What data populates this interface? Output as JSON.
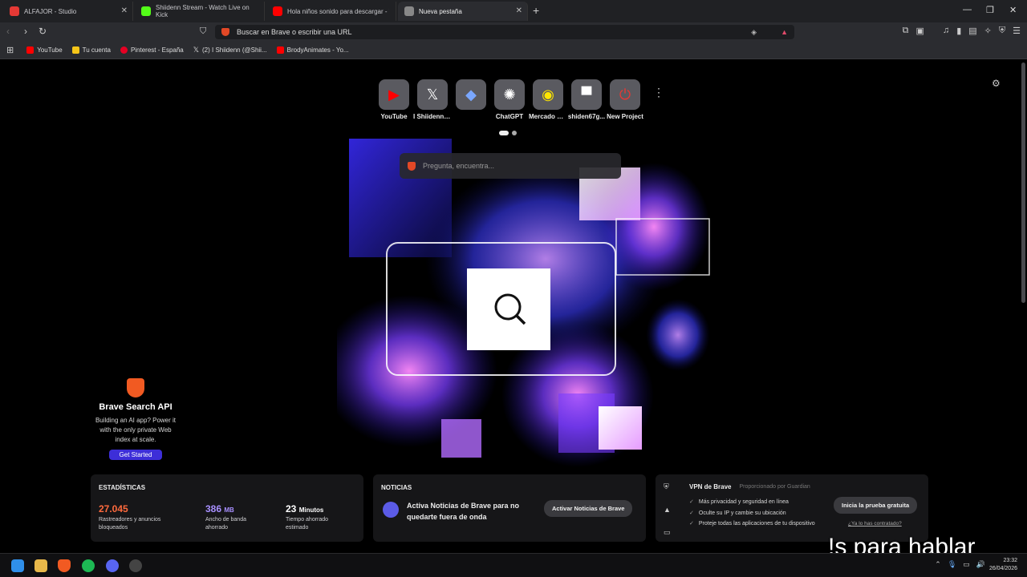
{
  "tabs": [
    {
      "title": "ALFAJOR - Studio",
      "favicon_color": "#e53935"
    },
    {
      "title": "Shiidenn Stream - Watch Live on Kick",
      "favicon_color": "#53fc18"
    },
    {
      "title": "Hola niños sonido para descargar - Y",
      "favicon_color": "#ff0000"
    },
    {
      "title": "Nueva pestaña",
      "favicon_color": "#888888"
    }
  ],
  "toolbar": {
    "address_placeholder": "Buscar en Brave o escribir una URL"
  },
  "bookmarks": [
    {
      "label": "YouTube",
      "color": "#ff0000"
    },
    {
      "label": "Tu cuenta",
      "color": "#f5c518"
    },
    {
      "label": "Pinterest - España",
      "color": "#e60023"
    },
    {
      "label": "(2) I Shiidenn (@Shii...",
      "color": "#ffffff"
    },
    {
      "label": "BrodyAnimates - Yo...",
      "color": "#ff0000"
    }
  ],
  "top_sites": [
    {
      "label": "YouTube",
      "icon": "youtube-icon",
      "color": "#ff0000",
      "glyph": "▶"
    },
    {
      "label": "I Shiidenn (... necesito q...",
      "icon": "x-icon",
      "color": "#ffffff",
      "glyph": "𝕏"
    },
    {
      "label": "",
      "icon": "gemini-icon",
      "color": "#7aa7ff",
      "glyph": "◆"
    },
    {
      "label": "ChatGPT",
      "icon": "chatgpt-icon",
      "color": "#ffffff",
      "glyph": "✺"
    },
    {
      "label": "Mercado Li...",
      "icon": "mercadolibre-icon",
      "color": "#ffe600",
      "glyph": "◉"
    },
    {
      "label": "shiden67g...",
      "icon": "site-icon",
      "color": "#ffffff",
      "glyph": "▀"
    },
    {
      "label": "New Project",
      "icon": "project-icon",
      "color": "#e53935",
      "glyph": "⏻"
    }
  ],
  "ask_placeholder": "Pregunta, encuentra...",
  "api_promo": {
    "title": "Brave Search API",
    "description": "Building an AI app? Power it with the only private Web index at scale.",
    "button": "Get Started"
  },
  "stats": {
    "heading": "ESTADÍSTICAS",
    "trackers_value": "27.045",
    "trackers_label": "Rastreadores y anuncios bloqueados",
    "bandwidth_value": "386",
    "bandwidth_unit": "MB",
    "bandwidth_label": "Ancho de banda ahorrado",
    "time_value": "23",
    "time_unit": "Minutos",
    "time_label": "Tiempo ahorrado estimado",
    "colors": {
      "trackers": "#ff6a3d",
      "bandwidth": "#a890ff",
      "time": "#ffffff"
    }
  },
  "news": {
    "heading": "NOTICIAS",
    "text": "Activa Noticias de Brave para no quedarte fuera de onda",
    "button": "Activar Noticias de Brave"
  },
  "vpn": {
    "title": "VPN de Brave",
    "provider": "Proporcionado por Guardian",
    "features": [
      "Más privacidad y seguridad en línea",
      "Oculte su IP y cambie su ubicación",
      "Proteje todas las aplicaciones de tu dispositivo"
    ],
    "button": "Inicia la prueba gratuita",
    "link": "¿Ya lo has contratado?"
  },
  "caption": "!s para hablar",
  "clock": {
    "time": "23:32",
    "date": "26/04/2026"
  }
}
